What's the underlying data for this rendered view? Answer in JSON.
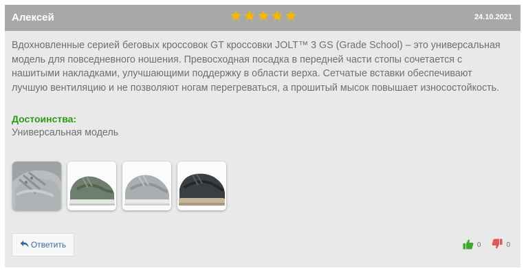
{
  "review": {
    "author": "Алексей",
    "rating": 5,
    "rating_max": 5,
    "date": "24.10.2021",
    "text": "Вдохновленные серией беговых кроссовок GT кроссовки JOLT™ 3 GS (Grade School) – это универсальная модель для повседневного ношения. Превосходная посадка в передней части стопы сочетается с нашитыми накладками, улучшающими поддержку в области верха. Сетчатые вставки обеспечивают лучшую вентиляцию и не позволяют ногам перегреваться, а прошитый мысок повышает износостойкость.",
    "pros_label": "Достоинства:",
    "pros_text": "Универсальная модель",
    "photos": [
      "gray sneaker",
      "green sneaker",
      "light gray sneaker",
      "dark sneaker"
    ]
  },
  "actions": {
    "reply_label": "Ответить",
    "likes": "0",
    "dislikes": "0"
  },
  "colors": {
    "header_bg": "#a8a8a8",
    "card_bg": "#e9e9e9",
    "star": "#f5b800",
    "pros_green": "#2a9a12",
    "like_green": "#3aa82a",
    "dislike_red": "#e05858",
    "link_blue": "#34689c"
  },
  "icons": {
    "star": "star-icon",
    "reply": "reply-arrow-icon",
    "like": "thumbs-up-icon",
    "dislike": "thumbs-down-icon"
  }
}
